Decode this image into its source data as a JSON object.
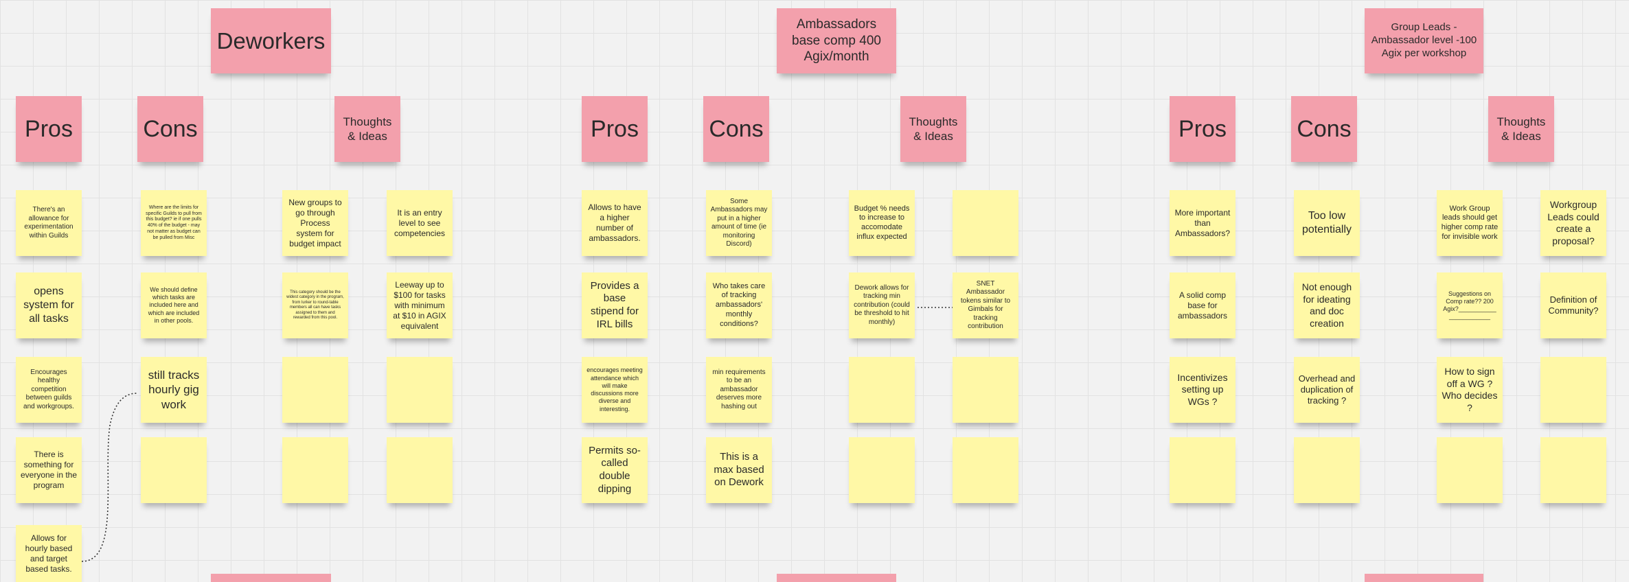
{
  "app": {
    "name": "Miro-style whiteboard"
  },
  "colors": {
    "header_note": "#f3a0ac",
    "sticky_note": "#fff8a6",
    "background": "#f2f2f2",
    "grid": "#e2e2e2"
  },
  "sections": [
    {
      "title": "Deworkers",
      "labels": {
        "pros": "Pros",
        "cons": "Cons",
        "thoughts": "Thoughts & Ideas"
      },
      "pros": [
        "There's an allowance for experimentation within Guilds",
        "opens system for all tasks",
        "Encourages healthy competition between guilds and workgroups.",
        "There is something for everyone in the program",
        "Allows for hourly based and target based tasks."
      ],
      "cons": [
        "Where are the limits for specific Guilds to pull from this budget? ie if one pulls 40% of the budget - may not matter as budget can be pulled from Misc",
        "We should define which tasks are included here and which are included in other pools.",
        "still  tracks hourly gig work",
        ""
      ],
      "thoughts_a": [
        "New groups to go through Process system for budget impact",
        "This category should be the widest category in the program, from lurker to round-table members all can have tasks assigned to them and rewarded from this pool.",
        "",
        ""
      ],
      "thoughts_b": [
        "It is an entry level to see competencies",
        "Leeway up to $100 for tasks with minimum at $10 in AGIX equivalent",
        "",
        ""
      ]
    },
    {
      "title": "Ambassadors base comp 400 Agix/month",
      "labels": {
        "pros": "Pros",
        "cons": "Cons",
        "thoughts": "Thoughts & Ideas"
      },
      "pros": [
        "Allows to have a higher number of ambassadors.",
        "Provides a base stipend for IRL bills",
        "encourages meeting attendance which will make discussions more diverse and interesting.",
        "Permits so-called double dipping"
      ],
      "cons": [
        "Some Ambassadors may put in a higher amount of time (ie monitoring Discord)",
        "Who takes care of tracking ambassadors' monthly conditions?",
        "min requirements to be an ambassador deserves more hashing out",
        "This is a max based on Dework"
      ],
      "thoughts_a": [
        "Budget % needs to increase to accomodate influx expected",
        "Dework allows for tracking min contribution (could be threshold to hit monthly)",
        "",
        ""
      ],
      "thoughts_b": [
        "",
        "SNET Ambassador tokens similar to Gimbals for tracking contribution",
        "",
        ""
      ]
    },
    {
      "title": "Group Leads - Ambassador level -100 Agix per workshop",
      "labels": {
        "pros": "Pros",
        "cons": "Cons",
        "thoughts": "Thoughts & Ideas"
      },
      "pros": [
        "More important than Ambassadors?",
        "A solid comp base for ambassadors",
        "Incentivizes setting up WGs ?",
        ""
      ],
      "cons": [
        "Too low potentially",
        "Not enough for ideating and doc creation",
        "Overhead and duplication of tracking ?",
        ""
      ],
      "thoughts_a": [
        "Work Group leads should get higher comp rate for invisible work",
        "Suggestions on Comp rate?? 200 Agix?___________ ____________",
        "How to sign off a WG ? Who decides ?",
        ""
      ],
      "thoughts_b": [
        "Workgroup Leads could create a proposal?",
        "Definition of Community?",
        "",
        ""
      ]
    }
  ]
}
